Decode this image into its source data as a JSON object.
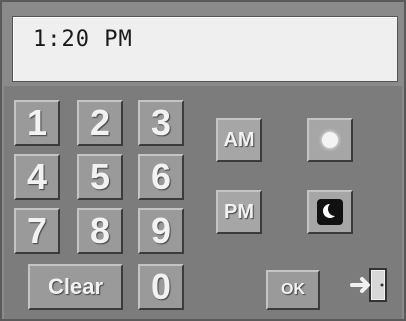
{
  "display": {
    "time": "1:20 PM"
  },
  "keypad": {
    "row1": [
      "1",
      "2",
      "3"
    ],
    "row2": [
      "4",
      "5",
      "6"
    ],
    "row3": [
      "7",
      "8",
      "9"
    ],
    "clear_label": "Clear",
    "zero_label": "0"
  },
  "mode": {
    "am_label": "AM",
    "pm_label": "PM"
  },
  "icons": {
    "day": "sun-icon",
    "night": "moon-icon",
    "exit": "exit-door-icon"
  },
  "ok_label": "OK"
}
